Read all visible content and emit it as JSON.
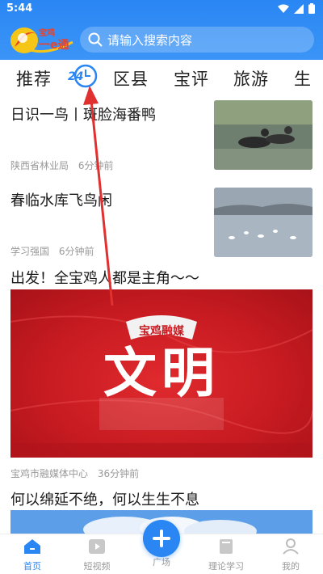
{
  "status_bar": {
    "time": "5:44"
  },
  "header": {
    "logo_text_top": "宝鸡",
    "logo_text_bottom": "一e通",
    "search_placeholder": "请输入搜索内容"
  },
  "tabs": [
    {
      "label": "推荐"
    },
    {
      "label": "24"
    },
    {
      "label": "区县"
    },
    {
      "label": "宝评"
    },
    {
      "label": "旅游"
    },
    {
      "label": "生"
    }
  ],
  "news": [
    {
      "title": "日识一鸟丨斑脸海番鸭",
      "source": "陕西省林业局",
      "time": "6分钟前"
    },
    {
      "title": "春临水库飞鸟闲",
      "source": "学习强国",
      "time": "6分钟前"
    },
    {
      "title": "出发！全宝鸡人都是主角～～",
      "source": "宝鸡市融媒体中心",
      "time": "36分钟前"
    },
    {
      "title": "何以绵延不绝，何以生生不息"
    }
  ],
  "banner": {
    "brand": "宝鸡融媒",
    "headline": "文明"
  },
  "bottom_nav": [
    {
      "label": "首页",
      "active": true
    },
    {
      "label": "短视频"
    },
    {
      "label": "广场"
    },
    {
      "label": "理论学习"
    },
    {
      "label": "我的"
    }
  ],
  "colors": {
    "accent": "#2a86f3",
    "banner_red": "#c71b21",
    "annotation_arrow": "#e03030"
  }
}
